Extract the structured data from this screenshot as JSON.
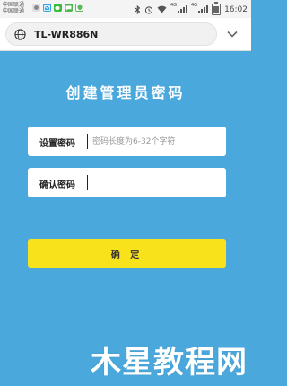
{
  "status_bar": {
    "carrier_1": "中国联通",
    "carrier_2": "中国联通",
    "network_1": "4G",
    "network_2": "4G",
    "time": "16:02",
    "icons": [
      "notification-icon",
      "mail-icon",
      "wechat-icon",
      "message-icon",
      "shield-icon",
      "bluetooth-icon",
      "alarm-icon",
      "wifi-icon",
      "signal-icon",
      "battery-icon"
    ]
  },
  "browser": {
    "url": "TL-WR886N",
    "icons": [
      "globe-icon",
      "chevron-down-icon"
    ]
  },
  "form": {
    "title": "创建管理员密码",
    "set_password_label": "设置密码",
    "set_password_placeholder": "密码长度为6-32个字符",
    "set_password_value": "",
    "confirm_password_label": "确认密码",
    "confirm_password_placeholder": "",
    "confirm_password_value": "",
    "confirm_button": "确 定"
  },
  "watermark": "木星教程网",
  "colors": {
    "background": "#4aa8dc",
    "button": "#f8e21c",
    "field": "#ffffff",
    "status_bar": "#f4f4f4"
  }
}
